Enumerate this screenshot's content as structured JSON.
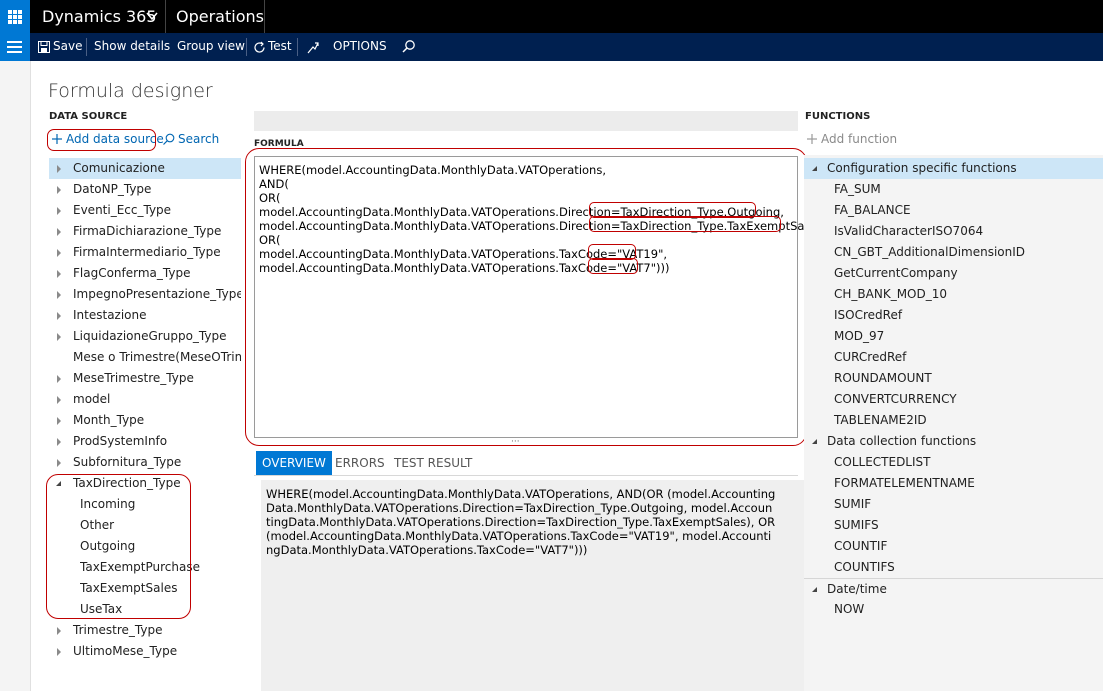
{
  "header": {
    "brand": "Dynamics 365",
    "module": "Operations"
  },
  "actions": {
    "save": "Save",
    "show_details": "Show details",
    "group_view": "Group view",
    "test": "Test",
    "options": "OPTIONS"
  },
  "page": {
    "title": "Formula designer"
  },
  "data_source": {
    "heading": "DATA SOURCE",
    "add_label": "Add data source",
    "search_label": "Search",
    "items": [
      {
        "label": "Comunicazione",
        "expandable": true
      },
      {
        "label": "DatoNP_Type",
        "expandable": true
      },
      {
        "label": "Eventi_Ecc_Type",
        "expandable": true
      },
      {
        "label": "FirmaDichiarazione_Type",
        "expandable": true
      },
      {
        "label": "FirmaIntermediario_Type",
        "expandable": true
      },
      {
        "label": "FlagConferma_Type",
        "expandable": true
      },
      {
        "label": "ImpegnoPresentazione_Type",
        "expandable": true
      },
      {
        "label": "Intestazione",
        "expandable": true
      },
      {
        "label": "LiquidazioneGruppo_Type",
        "expandable": true
      },
      {
        "label": "Mese o Trimestre(MeseOTrimes",
        "expandable": false
      },
      {
        "label": "MeseTrimestre_Type",
        "expandable": true
      },
      {
        "label": "model",
        "expandable": true
      },
      {
        "label": "Month_Type",
        "expandable": true
      },
      {
        "label": "ProdSystemInfo",
        "expandable": true
      },
      {
        "label": "Subfornitura_Type",
        "expandable": true
      },
      {
        "label": "TaxDirection_Type",
        "expandable": true,
        "expanded": true
      },
      {
        "label": "Trimestre_Type",
        "expandable": true
      },
      {
        "label": "UltimoMese_Type",
        "expandable": true
      }
    ],
    "tax_children": [
      "Incoming",
      "Other",
      "Outgoing",
      "TaxExemptPurchase",
      "TaxExemptSales",
      "UseTax"
    ]
  },
  "formula": {
    "heading": "FORMULA",
    "lines": [
      "WHERE(model.AccountingData.MonthlyData.VATOperations,",
      "AND(",
      "OR(",
      "model.AccountingData.MonthlyData.VATOperations.Direction=TaxDirection_Type.Outgoing,",
      "model.AccountingData.MonthlyData.VATOperations.Direction=TaxDirection_Type.TaxExemptSales),",
      "OR(",
      "model.AccountingData.MonthlyData.VATOperations.TaxCode=\"VAT19\",",
      "model.AccountingData.MonthlyData.VATOperations.TaxCode=\"VAT7\")))"
    ],
    "tabs": [
      "OVERVIEW",
      "ERRORS",
      "TEST RESULT"
    ],
    "active_tab": "OVERVIEW",
    "overview_text": "WHERE(model.AccountingData.MonthlyData.VATOperations, AND(OR (model.AccountingData.MonthlyData.VATOperations.Direction=TaxDirection_Type.Outgoing, model.AccountingData.MonthlyData.VATOperations.Direction=TaxDirection_Type.TaxExemptSales), OR(model.AccountingData.MonthlyData.VATOperations.TaxCode=\"VAT19\", model.AccountingData.MonthlyData.VATOperations.TaxCode=\"VAT7\")))"
  },
  "functions": {
    "heading": "FUNCTIONS",
    "add_label": "Add function",
    "groups": [
      {
        "label": "Configuration specific functions",
        "items": [
          "FA_SUM",
          "FA_BALANCE",
          "IsValidCharacterISO7064",
          "CN_GBT_AdditionalDimensionID",
          "GetCurrentCompany",
          "CH_BANK_MOD_10",
          "ISOCredRef",
          "MOD_97",
          "CURCredRef",
          "ROUNDAMOUNT",
          "CONVERTCURRENCY",
          "TABLENAME2ID"
        ]
      },
      {
        "label": "Data collection functions",
        "items": [
          "COLLECTEDLIST",
          "FORMATELEMENTNAME",
          "SUMIF",
          "SUMIFS",
          "COUNTIF",
          "COUNTIFS"
        ]
      },
      {
        "label": "Date/time",
        "items": [
          "NOW"
        ]
      }
    ]
  },
  "colors": {
    "accent": "#0078d4",
    "navbar": "#002050",
    "topbar": "#000000",
    "annotation": "#c00000"
  }
}
